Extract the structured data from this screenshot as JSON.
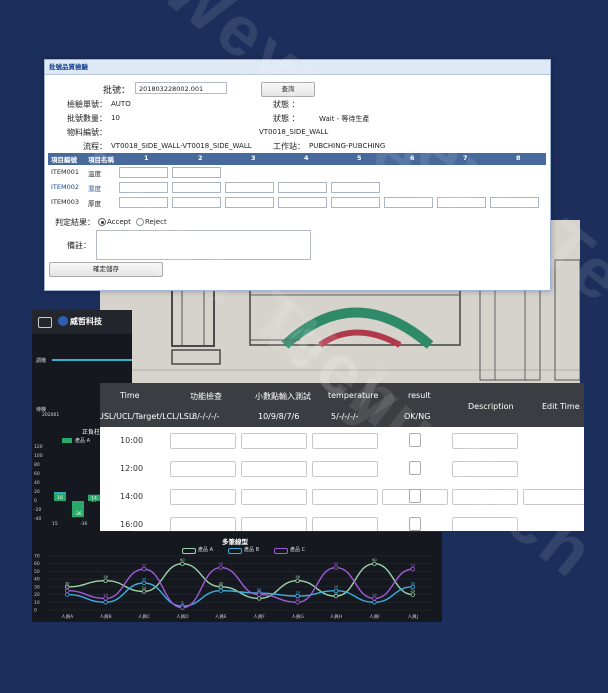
{
  "form": {
    "title": "批號品質檢驗",
    "batch_label": "批號：",
    "batch_value": "201803228002.001",
    "query_button": "查詢",
    "inspect_no_label": "檢驗單號：",
    "inspect_no_value": "AUTO",
    "status1_label": "狀態 ：",
    "status1_value": "",
    "qty_label": "批號數量：",
    "qty_value": "10",
    "status2_label": "狀態 ：",
    "status2_value": "Wait - 等待生產",
    "material_label": "物料編號：",
    "material_value": "VT0018_SIDE_WALL",
    "flow_label": "流程：",
    "flow_value": "VT0018_SIDE_WALL-VT0018_SIDE_WALL",
    "station_label": "工作站：",
    "station_value": "PUBCHING-PUBCHING",
    "grid": {
      "col_code": "項目編號",
      "col_name": "項目名稱",
      "columns": [
        "1",
        "2",
        "3",
        "4",
        "5",
        "6",
        "7",
        "8"
      ],
      "rows": [
        {
          "code": "ITEM001",
          "name": "溫度",
          "cells": 2
        },
        {
          "code": "ITEM002",
          "name": "濕度",
          "cells": 5
        },
        {
          "code": "ITEM003",
          "name": "厚度",
          "cells": 8
        }
      ]
    },
    "result_label": "判定結果：",
    "accept_label": "Accept",
    "reject_label": "Reject",
    "remark_label": "備註：",
    "confirm_button": "確定儲存"
  },
  "table": {
    "headers": [
      "Time",
      "功能檢查",
      "小數點輸入測試",
      "temperature",
      "result",
      "Description",
      "Edit Time"
    ],
    "subheaders": [
      "USL/UCL/Target/LCL/LSL",
      "8/-/-/-/-",
      "10/9/8/7/6",
      "5/-/-/-/-",
      "OK/NG"
    ],
    "rows": [
      "10:00",
      "12:00",
      "14:00",
      "16:00"
    ]
  },
  "dashboard": {
    "logo_text": "威哲科技",
    "label_a": "調機",
    "label_b": "待機",
    "date": "202001",
    "chart_title": "正負柱",
    "legend": "產品 A",
    "y_ticks": [
      "120",
      "100",
      "80",
      "60",
      "40",
      "20",
      "0",
      "-20",
      "-40"
    ],
    "bar_labels": [
      "20",
      "16",
      "10",
      "14",
      "-36",
      "-30"
    ],
    "x_ticks": [
      "15",
      "-36",
      "14"
    ]
  },
  "chart_data": {
    "type": "line",
    "title": "多筆線型",
    "categories": [
      "人員A",
      "人員B",
      "人員C",
      "人員D",
      "人員E",
      "人員F",
      "人員G",
      "人員H",
      "人員I",
      "人員J"
    ],
    "ylim": [
      0,
      70
    ],
    "y_ticks": [
      "70",
      "60",
      "50",
      "40",
      "30",
      "20",
      "10",
      "0"
    ],
    "series": [
      {
        "name": "產品 A",
        "color": "#9ad3a8",
        "values": [
          30,
          38,
          24,
          60,
          30,
          15,
          38,
          18,
          60,
          20
        ]
      },
      {
        "name": "產品 B",
        "color": "#3aaee0",
        "values": [
          20,
          10,
          35,
          5,
          25,
          22,
          18,
          25,
          10,
          30
        ]
      },
      {
        "name": "產品 C",
        "color": "#a05ad8",
        "values": [
          25,
          15,
          53,
          3,
          55,
          20,
          10,
          55,
          15,
          53
        ]
      }
    ]
  },
  "watermark": "Weyu Tech",
  "colors": {
    "background": "#1c2f5c",
    "form_header": "#47699b",
    "form_title_bg": "#dfe8f5",
    "table_header": "#3a3d41"
  }
}
